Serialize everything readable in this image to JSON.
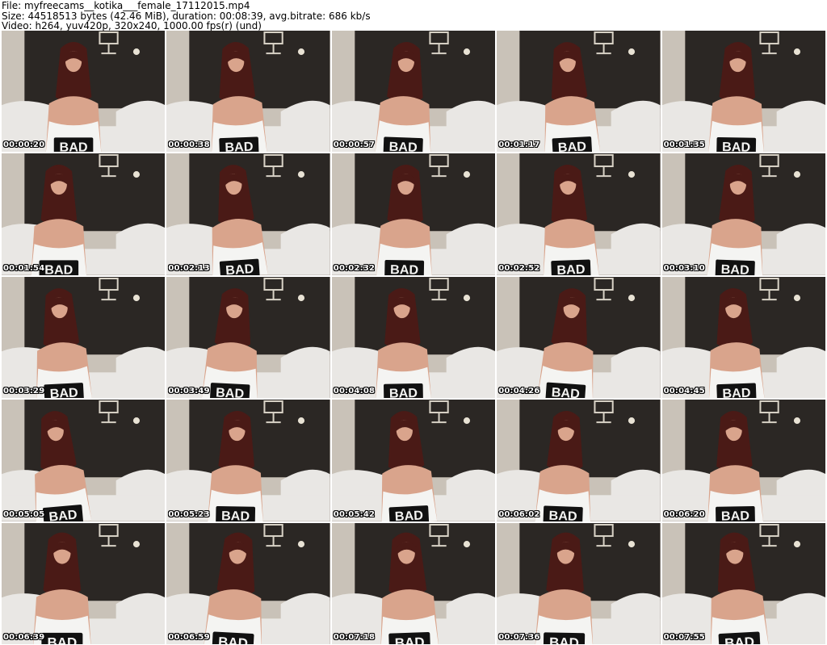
{
  "header": {
    "file_line": "File: myfreecams__kotika___female_17112015.mp4",
    "size_line": "Size: 44518513 bytes (42.46 MiB), duration: 00:08:39, avg.bitrate: 686 kb/s",
    "video_line": "Video: h264, yuv420p, 320x240, 1000.00 fps(r) (und)"
  },
  "thumbnails": [
    {
      "timestamp": "00:00:20"
    },
    {
      "timestamp": "00:00:38"
    },
    {
      "timestamp": "00:00:57"
    },
    {
      "timestamp": "00:01:17"
    },
    {
      "timestamp": "00:01:35"
    },
    {
      "timestamp": "00:01:54"
    },
    {
      "timestamp": "00:02:13"
    },
    {
      "timestamp": "00:02:32"
    },
    {
      "timestamp": "00:02:52"
    },
    {
      "timestamp": "00:03:10"
    },
    {
      "timestamp": "00:03:29"
    },
    {
      "timestamp": "00:03:49"
    },
    {
      "timestamp": "00:04:08"
    },
    {
      "timestamp": "00:04:26"
    },
    {
      "timestamp": "00:04:45"
    },
    {
      "timestamp": "00:05:05"
    },
    {
      "timestamp": "00:05:23"
    },
    {
      "timestamp": "00:05:42"
    },
    {
      "timestamp": "00:06:02"
    },
    {
      "timestamp": "00:06:20"
    },
    {
      "timestamp": "00:06:39"
    },
    {
      "timestamp": "00:06:59"
    },
    {
      "timestamp": "00:07:18"
    },
    {
      "timestamp": "00:07:36"
    },
    {
      "timestamp": "00:07:55"
    }
  ],
  "shirt_text": "BAD",
  "colors": {
    "wall_dark": "#2b2724",
    "wall_light": "#c9c2b8",
    "sofa": "#e9e7e4",
    "hair": "#4a1a16",
    "skin": "#d9a48c",
    "shirt": "#f4f4f2",
    "shirt_print": "#111111"
  }
}
